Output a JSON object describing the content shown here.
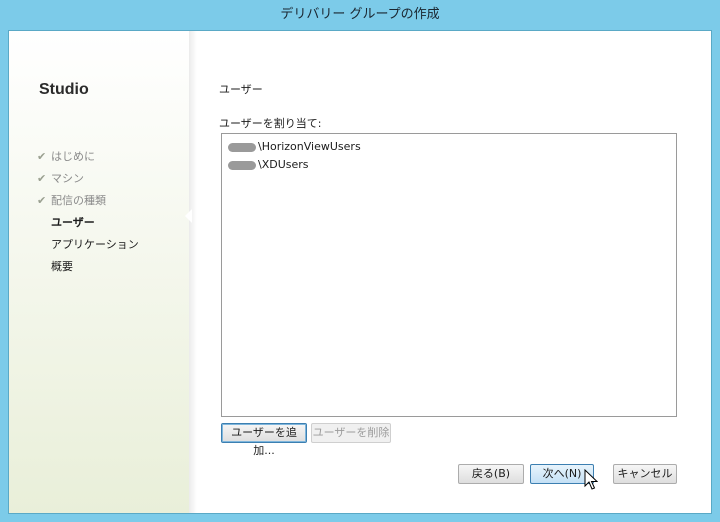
{
  "window": {
    "title": "デリバリー グループの作成"
  },
  "sidebar": {
    "app_name": "Studio",
    "steps": [
      {
        "label": "はじめに",
        "state": "done"
      },
      {
        "label": "マシン",
        "state": "done"
      },
      {
        "label": "配信の種類",
        "state": "done"
      },
      {
        "label": "ユーザー",
        "state": "current"
      },
      {
        "label": "アプリケーション",
        "state": "pending"
      },
      {
        "label": "概要",
        "state": "pending"
      }
    ]
  },
  "main": {
    "section_title": "ユーザー",
    "assign_label": "ユーザーを割り当て:",
    "users": [
      {
        "name": "\\HorizonViewUsers"
      },
      {
        "name": "\\XDUsers"
      }
    ],
    "add_user_label": "ユーザーを追加...",
    "remove_user_label": "ユーザーを削除"
  },
  "footer": {
    "back_label": "戻る(B)",
    "next_label": "次へ(N)",
    "cancel_label": "キャンセル"
  },
  "icons": {
    "check": "check-icon",
    "cursor": "mouse-pointer-icon"
  },
  "colors": {
    "titlebar": "#7ccbe9",
    "accent": "#3c7fb1"
  }
}
